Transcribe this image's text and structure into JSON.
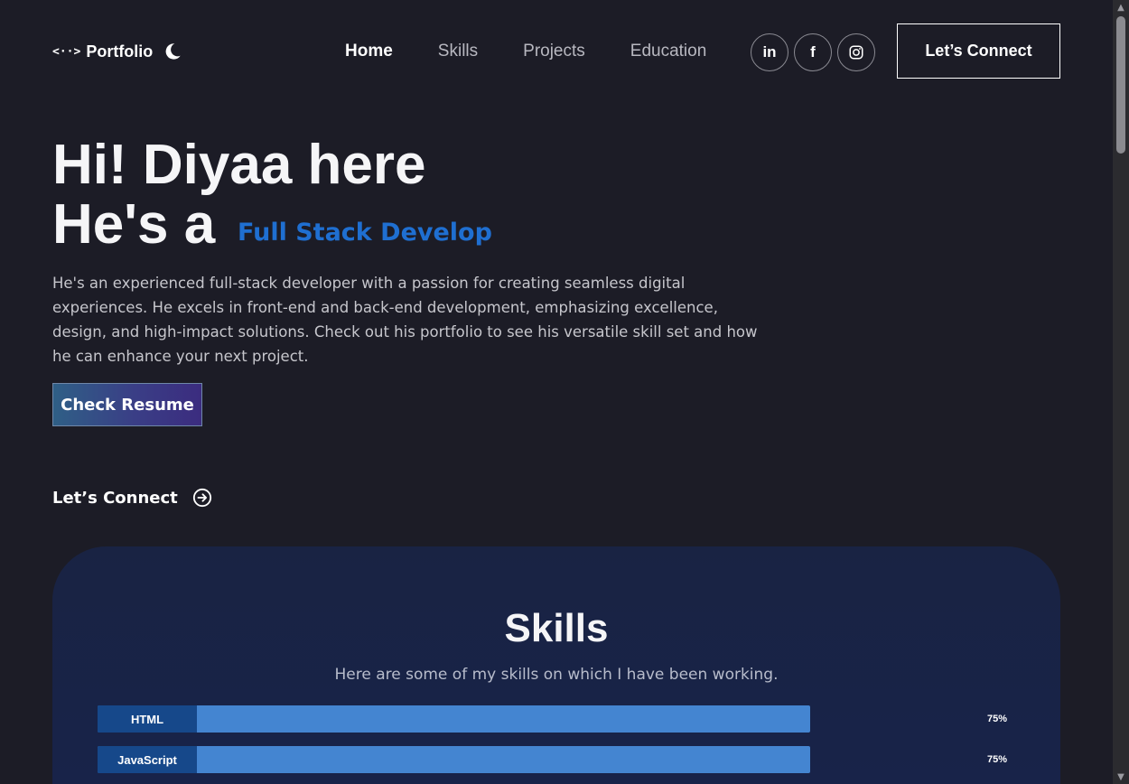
{
  "nav": {
    "brand_icon": "<··>",
    "brand_label": "Portfolio",
    "theme_icon": "moon-icon",
    "links": [
      {
        "label": "Home",
        "active": true
      },
      {
        "label": "Skills",
        "active": false
      },
      {
        "label": "Projects",
        "active": false
      },
      {
        "label": "Education",
        "active": false
      }
    ],
    "socials": [
      "in",
      "f",
      "instagram-icon"
    ],
    "connect_label": "Let’s Connect"
  },
  "hero": {
    "line1": "Hi! Diyaa here",
    "line2": "He's a",
    "role": "Full Stack Develop",
    "description": "He's an experienced full-stack developer with a passion for creating seamless digital experiences. He excels in front-end and back-end development, emphasizing excellence, design, and high-impact solutions. Check out his portfolio to see his versatile skill set and how he can enhance your next project.",
    "resume_label": "Check Resume",
    "connect_label": "Let’s Connect",
    "accent_color": "#1f6fd1"
  },
  "skills": {
    "title": "Skills",
    "subtitle": "Here are some of my skills on which I have been working.",
    "items": [
      {
        "name": "HTML",
        "percent": "75%",
        "level": 75
      },
      {
        "name": "JavaScript",
        "percent": "75%",
        "level": 75
      }
    ]
  }
}
